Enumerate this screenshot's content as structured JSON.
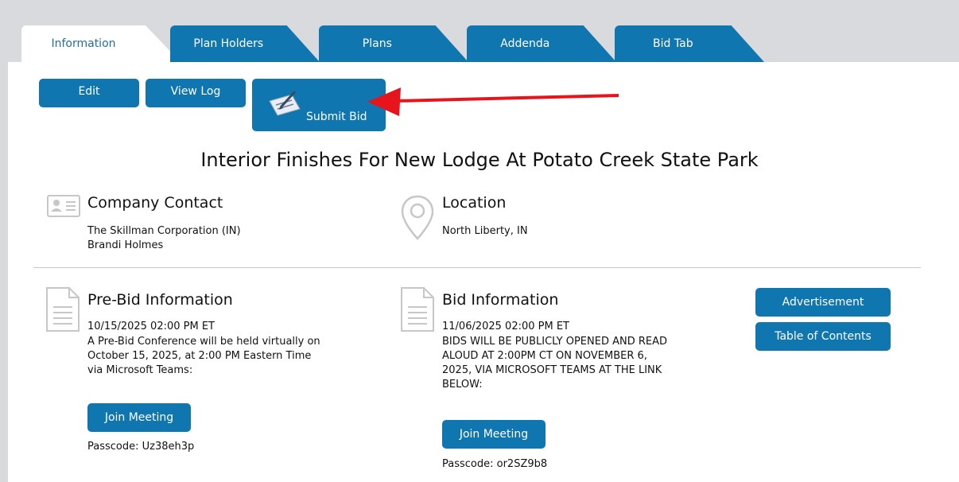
{
  "tabs": [
    {
      "label": "Information",
      "active": true
    },
    {
      "label": "Plan Holders",
      "active": false
    },
    {
      "label": "Plans",
      "active": false
    },
    {
      "label": "Addenda",
      "active": false
    },
    {
      "label": "Bid Tab",
      "active": false
    }
  ],
  "toolbar": {
    "edit_label": "Edit",
    "view_log_label": "View Log",
    "submit_bid_label": "Submit Bid"
  },
  "project_title": "Interior Finishes For New Lodge At Potato Creek State Park",
  "company_contact": {
    "heading": "Company Contact",
    "company": "The Skillman Corporation (IN)",
    "person": "Brandi Holmes"
  },
  "location": {
    "heading": "Location",
    "value": "North Liberty, IN"
  },
  "pre_bid": {
    "heading": "Pre-Bid Information",
    "datetime": "10/15/2025 02:00 PM ET",
    "desc_lines": [
      "A Pre-Bid Conference will be held virtually on",
      "October 15, 2025, at 2:00 PM Eastern Time",
      "via Microsoft Teams:"
    ],
    "join_label": "Join Meeting",
    "passcode": "Passcode: Uz38eh3p"
  },
  "bid_info": {
    "heading": "Bid Information",
    "datetime": "11/06/2025 02:00 PM ET",
    "desc_lines": [
      "BIDS WILL BE PUBLICLY OPENED AND READ",
      "ALOUD AT 2:00PM CT ON NOVEMBER 6,",
      "2025, VIA MICROSOFT TEAMS AT THE LINK",
      "BELOW:"
    ],
    "join_label": "Join Meeting",
    "passcode": "Passcode: or2SZ9b8"
  },
  "side_buttons": {
    "advertisement_label": "Advertisement",
    "toc_label": "Table of Contents"
  },
  "colors": {
    "accent": "#0f76b0",
    "arrow": "#e8141b",
    "background_strip": "#d9dade"
  }
}
